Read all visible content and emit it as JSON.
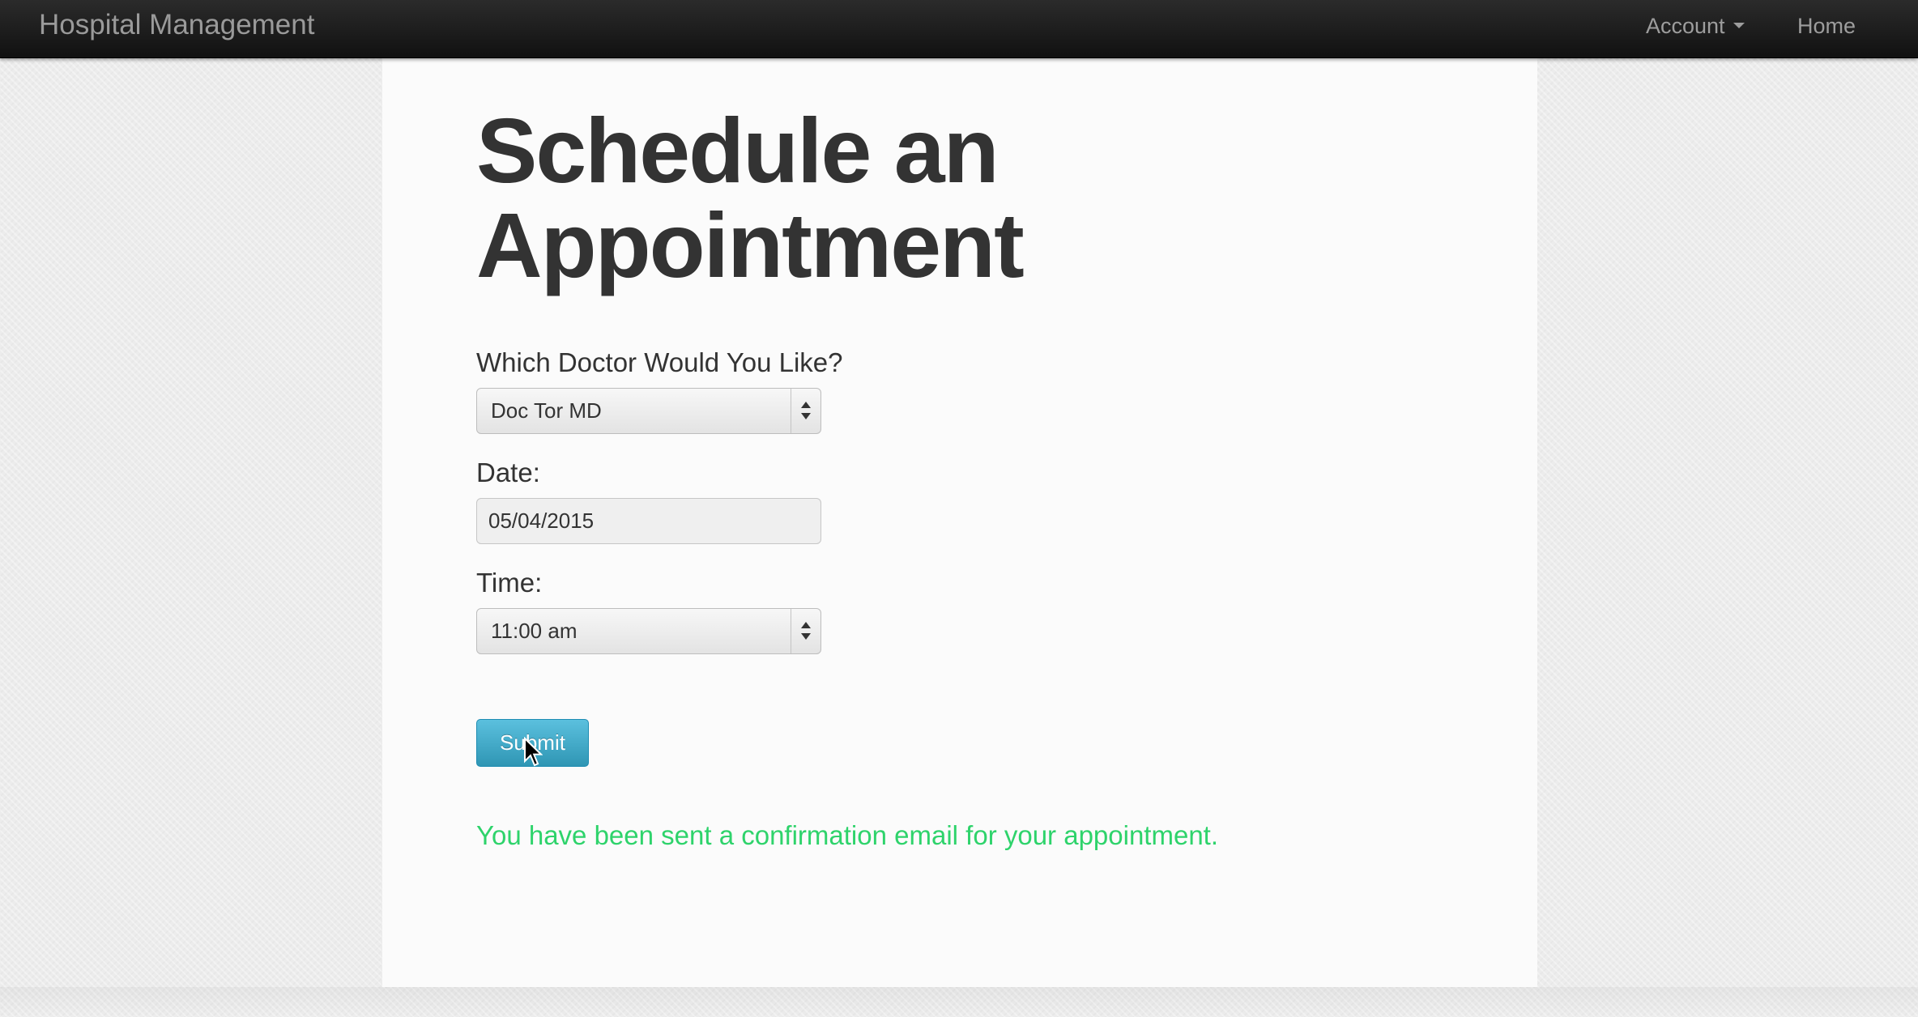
{
  "navbar": {
    "brand": "Hospital Management",
    "account_label": "Account",
    "home_label": "Home"
  },
  "page": {
    "title": "Schedule an Appointment"
  },
  "form": {
    "doctor_label": "Which Doctor Would You Like?",
    "doctor_selected": "Doc Tor MD",
    "date_label": "Date:",
    "date_value": "05/04/2015",
    "time_label": "Time:",
    "time_selected": "11:00 am",
    "submit_label": "Submit"
  },
  "status": {
    "confirmation": "You have been sent a confirmation email for your appointment."
  },
  "icons": {
    "account_dropdown": "caret-down-icon",
    "select_arrows": "up-down-arrows-icon",
    "cursor": "mouse-pointer-icon"
  },
  "colors": {
    "navbar": "#1a1a1a",
    "button": "#49afcd",
    "confirmation_text": "#2ed36b"
  }
}
